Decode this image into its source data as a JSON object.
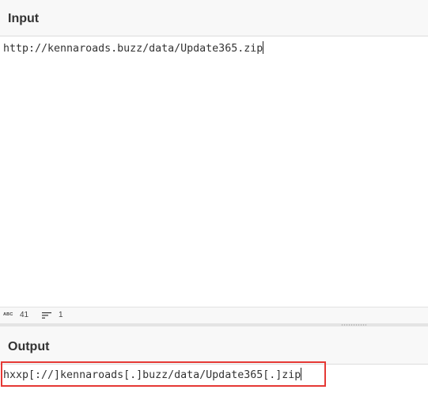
{
  "input_panel": {
    "title": "Input",
    "value": "http://kennaroads.buzz/data/Update365.zip"
  },
  "status_bar": {
    "length_icon": "abc-length-icon",
    "length_label": "ABC",
    "length_value": "41",
    "lines_icon": "lines-icon",
    "lines_value": "1"
  },
  "output_panel": {
    "title": "Output",
    "value": "hxxp[://]kennaroads[.]buzz/data/Update365[.]zip"
  },
  "colors": {
    "header_bg": "#f8f8f8",
    "highlight_border": "#e53935",
    "text": "#333333"
  }
}
